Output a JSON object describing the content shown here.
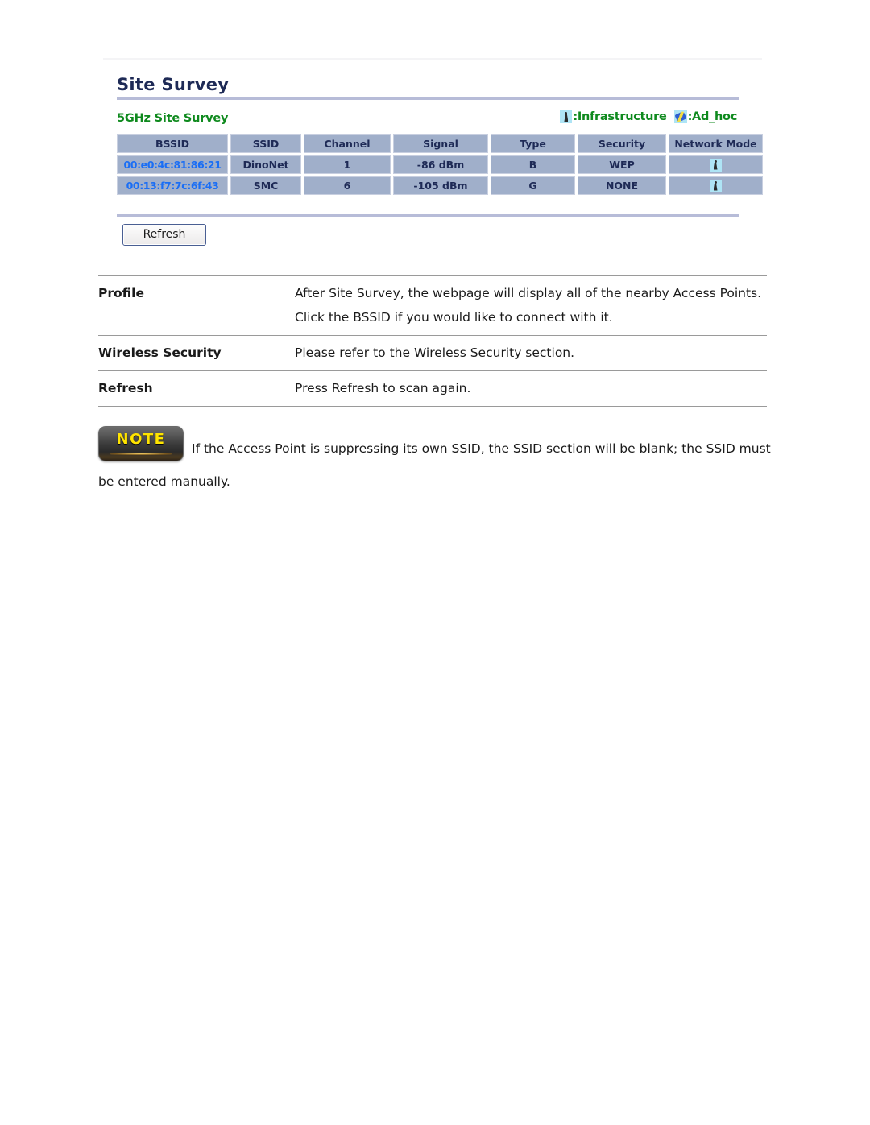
{
  "page": {
    "panel_title": "Site Survey",
    "section_title": "5GHz Site Survey"
  },
  "legend": {
    "infrastructure_icon": "infrastructure-icon",
    "infrastructure_label": ":Infrastructure",
    "adhoc_icon": "adhoc-icon",
    "adhoc_label": ":Ad_hoc"
  },
  "survey_table": {
    "columns": [
      "BSSID",
      "SSID",
      "Channel",
      "Signal",
      "Type",
      "Security",
      "Network Mode"
    ],
    "rows": [
      {
        "bssid": "00:e0:4c:81:86:21",
        "ssid": "DinoNet",
        "channel": "1",
        "signal": "-86 dBm",
        "type": "B",
        "security": "WEP",
        "network_mode": "infrastructure-icon"
      },
      {
        "bssid": "00:13:f7:7c:6f:43",
        "ssid": "SMC",
        "channel": "6",
        "signal": "-105 dBm",
        "type": "G",
        "security": "NONE",
        "network_mode": "infrastructure-icon"
      }
    ]
  },
  "buttons": {
    "refresh_label": "Refresh"
  },
  "descriptions": [
    {
      "key": "Profile",
      "value": "After Site Survey, the webpage will display all of the nearby Access Points. Click the BSSID if you would like to connect with it."
    },
    {
      "key": "Wireless Security",
      "value": "Please refer to the Wireless Security section."
    },
    {
      "key": "Refresh",
      "value": "Press Refresh to scan again."
    }
  ],
  "note": {
    "badge_label": "NOTE",
    "text": "If the Access Point is suppressing its own SSID, the SSID section will be blank; the SSID must be entered manually."
  },
  "colors": {
    "panel_title": "#1e2a56",
    "section_title": "#0f8a1e",
    "table_cell_bg": "#a0afca",
    "bssid_link": "#1a6ef5",
    "rule": "#b7bcd8",
    "note_badge_text": "#ffe400"
  }
}
